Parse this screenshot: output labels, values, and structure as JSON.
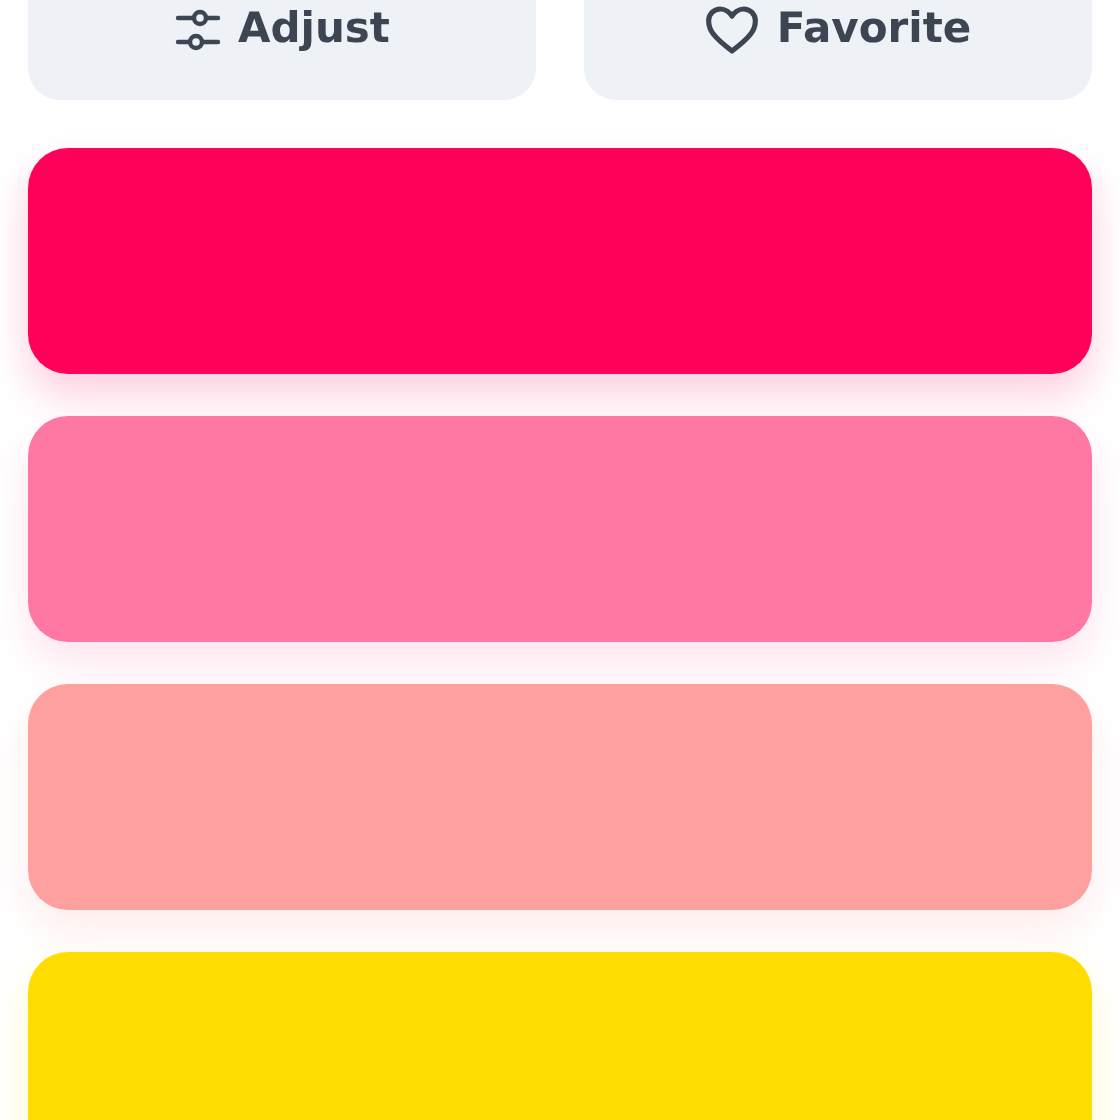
{
  "buttons": [
    {
      "label": "Adjust",
      "kind": "adjust"
    },
    {
      "label": "Favorite",
      "kind": "favorite"
    }
  ],
  "swatches": [
    {
      "color": "#ff005a"
    },
    {
      "color": "#ff77a3"
    },
    {
      "color": "#fea09e"
    },
    {
      "color": "#ffdd00"
    }
  ]
}
